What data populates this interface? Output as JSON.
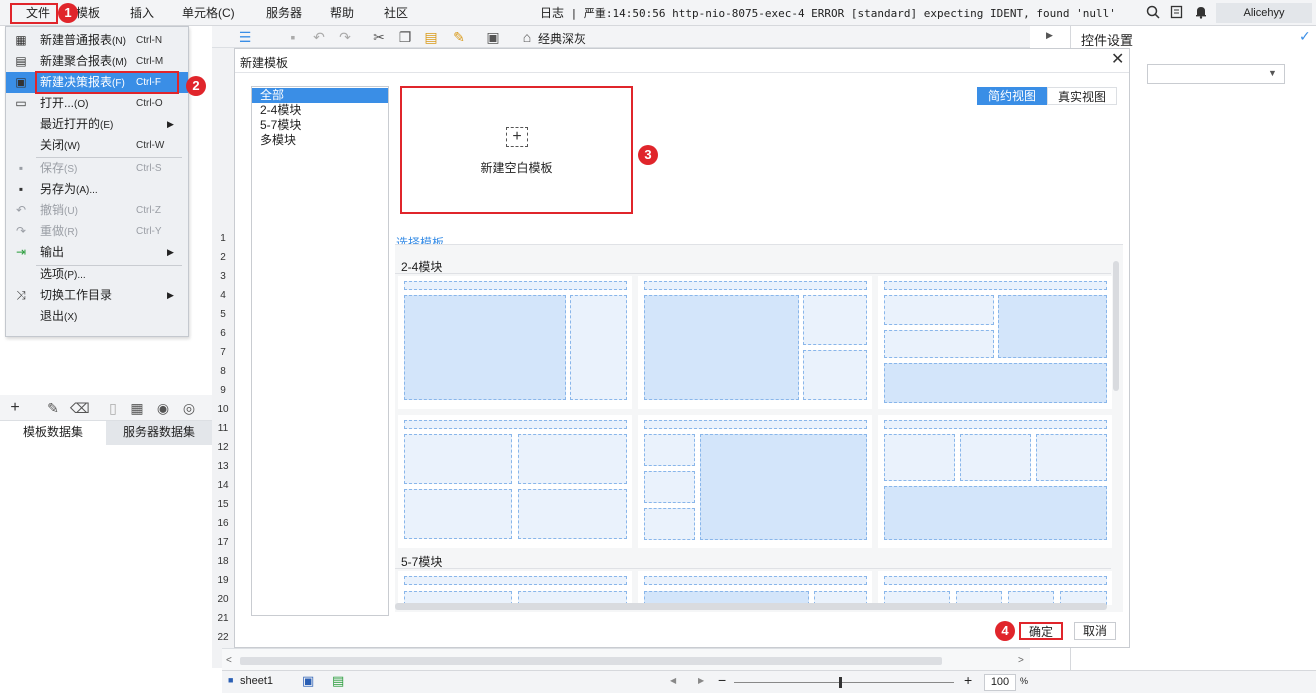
{
  "menubar": {
    "items": [
      "文件",
      "模板",
      "插入",
      "单元格(C)",
      "服务器",
      "帮助",
      "社区"
    ],
    "log_label": "日志",
    "log_message": "| 严重:14:50:56 http-nio-8075-exec-4 ERROR [standard] expecting IDENT, found 'null'",
    "user": "Alicehyy"
  },
  "file_menu": {
    "items": [
      {
        "label": "新建普通报表",
        "mnemonic": "(N)",
        "shortcut": "Ctrl-N",
        "icon": "report-grid-icon",
        "glyph": "▦",
        "enabled": true
      },
      {
        "label": "新建聚合报表",
        "mnemonic": "(M)",
        "shortcut": "Ctrl-M",
        "icon": "aggregate-report-icon",
        "glyph": "▤",
        "enabled": true
      },
      {
        "label": "新建决策报表",
        "mnemonic": "(F)",
        "shortcut": "Ctrl-F",
        "icon": "dashboard-report-icon",
        "glyph": "▣",
        "enabled": true
      },
      {
        "label": "打开...",
        "mnemonic": "(O)",
        "shortcut": "Ctrl-O",
        "icon": "folder-open-icon",
        "glyph": "▭",
        "enabled": true
      },
      {
        "label": "最近打开的",
        "mnemonic": "(E)",
        "shortcut": "",
        "icon": "",
        "glyph": "",
        "enabled": true,
        "submenu": true
      },
      {
        "label": "关闭",
        "mnemonic": "(W)",
        "shortcut": "Ctrl-W",
        "icon": "",
        "glyph": "",
        "enabled": true
      },
      {
        "label": "保存",
        "mnemonic": "(S)",
        "shortcut": "Ctrl-S",
        "icon": "save-icon",
        "glyph": "▪",
        "enabled": false
      },
      {
        "label": "另存为",
        "mnemonic": "(A)...",
        "shortcut": "",
        "icon": "save-as-icon",
        "glyph": "▪",
        "enabled": true
      },
      {
        "label": "撤销",
        "mnemonic": "(U)",
        "shortcut": "Ctrl-Z",
        "icon": "undo-icon",
        "glyph": "↶",
        "enabled": false
      },
      {
        "label": "重做",
        "mnemonic": "(R)",
        "shortcut": "Ctrl-Y",
        "icon": "redo-icon",
        "glyph": "↷",
        "enabled": false
      },
      {
        "label": "输出",
        "mnemonic": "",
        "shortcut": "",
        "icon": "export-icon",
        "glyph": "⇥",
        "enabled": true,
        "submenu": true
      },
      {
        "label": "选项",
        "mnemonic": "(P)...",
        "shortcut": "",
        "icon": "",
        "glyph": "",
        "enabled": true
      },
      {
        "label": "切换工作目录",
        "mnemonic": "",
        "shortcut": "",
        "icon": "switch-directory-icon",
        "glyph": "⤨",
        "enabled": true,
        "submenu": true
      },
      {
        "label": "退出",
        "mnemonic": "(X)",
        "shortcut": "",
        "icon": "",
        "glyph": "",
        "enabled": true
      }
    ]
  },
  "badges": [
    "1",
    "2",
    "3",
    "4"
  ],
  "toolbar": {
    "theme_label": "经典深灰"
  },
  "left_panel": {
    "tabs": [
      "模板数据集",
      "服务器数据集"
    ]
  },
  "sheet": {
    "row_numbers": [
      "1",
      "2",
      "3",
      "4",
      "5",
      "6",
      "7",
      "8",
      "9",
      "10",
      "11",
      "12",
      "13",
      "14",
      "15",
      "16",
      "17",
      "18",
      "19",
      "20",
      "21",
      "22"
    ],
    "tab_name": "sheet1",
    "zoom": "100",
    "zoom_unit": "%"
  },
  "right_panel": {
    "title": "控件设置"
  },
  "dialog": {
    "title": "新建模板",
    "categories": [
      "全部",
      "2-4模块",
      "5-7模块",
      "多模块"
    ],
    "selected_category": "全部",
    "blank_template_label": "新建空白模板",
    "view_tabs": [
      "简约视图",
      "真实视图"
    ],
    "select_section_label": "选择模板",
    "group_labels": [
      "2-4模块",
      "5-7模块"
    ],
    "confirm_label": "确定",
    "cancel_label": "取消"
  }
}
